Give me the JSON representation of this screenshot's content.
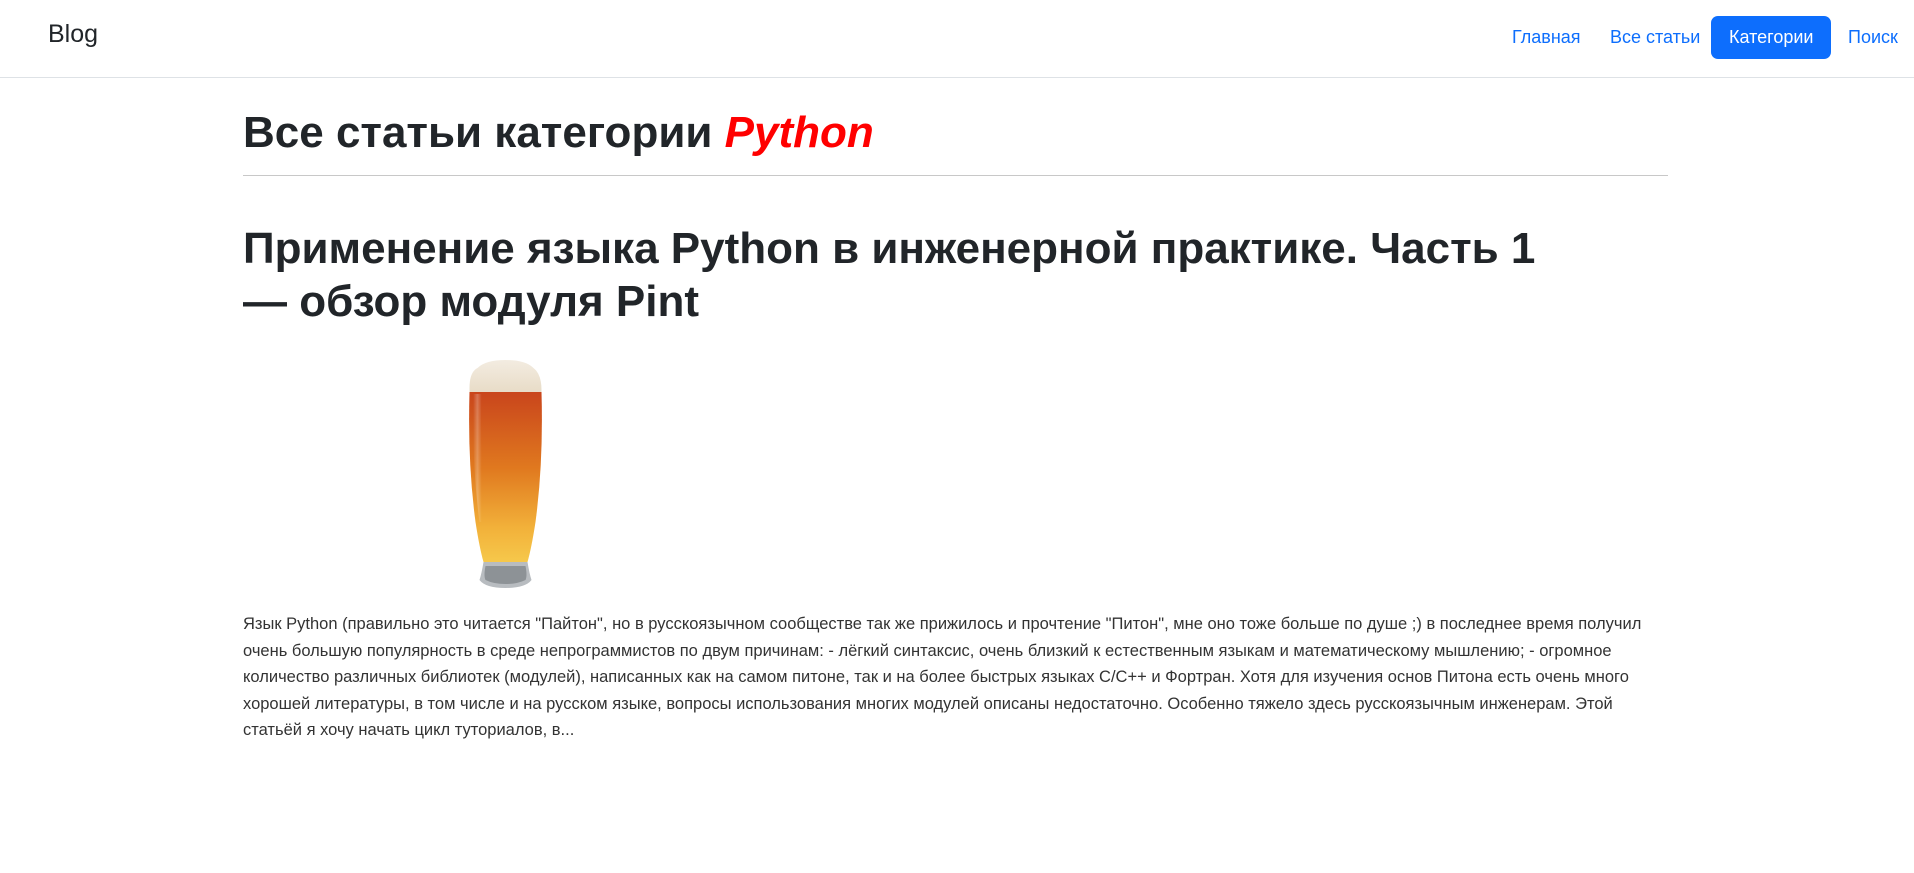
{
  "navbar": {
    "brand": "Blog",
    "links": [
      {
        "label": "Главная",
        "active": false
      },
      {
        "label": "Все статьи",
        "active": false
      },
      {
        "label": "Категории",
        "active": true
      },
      {
        "label": "Поиск",
        "active": false
      }
    ]
  },
  "page": {
    "heading_prefix": "Все статьи категории ",
    "category_name": "Python"
  },
  "post": {
    "title": "Применение языка Python в инженерной практике. Часть 1 — обзор модуля Pint",
    "image": "beer-glass-image",
    "excerpt": "Язык Python (правильно это читается \"Пайтон\", но в русскоязычном сообществе так же прижилось и прочтение \"Питон\", мне оно тоже больше по душе ;) в последнее время получил очень большую популярность в среде непрограммистов по двум причинам: - лёгкий синтаксис, очень близкий к естественным языкам и математическому мышлению; - огромное количество различных библиотек (модулей), написанных как на самом питоне, так и на более быстрых языках C/C++ и Фортран. Хотя для изучения основ Питона есть очень много хорошей литературы, в том числе и на русском языке, вопросы использования многих модулей описаны недостаточно. Особенно тяжело здесь русскоязычным инженерам. Этой статьёй я хочу начать цикл туториалов, в..."
  },
  "colors": {
    "accent": "#0d6efd",
    "category": "#ff0000",
    "text": "#212529"
  }
}
